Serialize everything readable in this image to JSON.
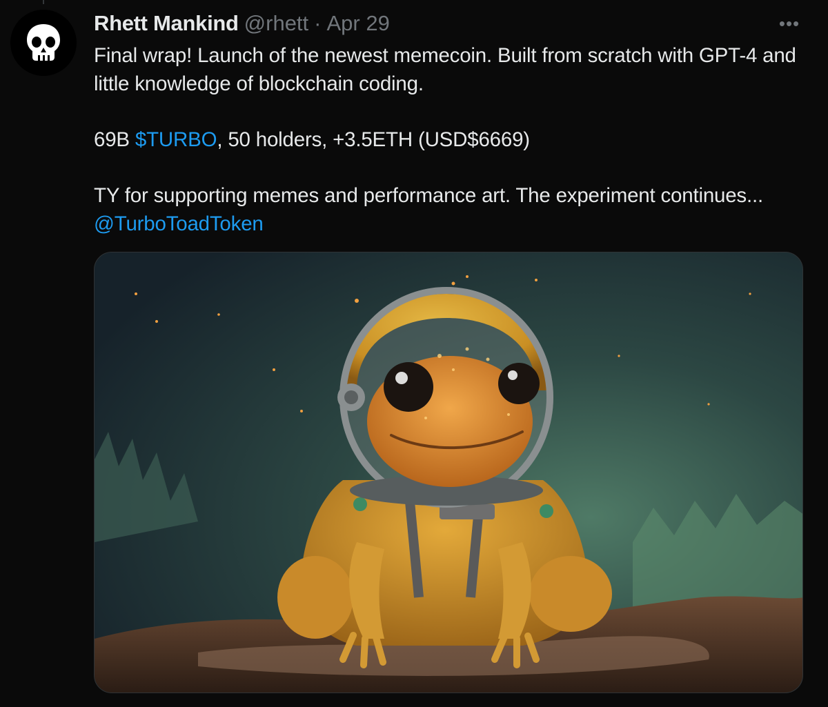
{
  "tweet": {
    "author": {
      "display_name": "Rhett Mankind",
      "handle": "@rhett",
      "avatar_icon": "skull-icon"
    },
    "separator": "·",
    "date": "Apr 29",
    "more_label": "•••",
    "text": {
      "line1": "Final wrap! Launch of the newest memecoin. Built from scratch with GPT-4 and little knowledge of blockchain coding.",
      "line2_prefix": "69B ",
      "line2_cashtag": "$TURBO",
      "line2_suffix": ", 50 holders, +3.5ETH (USD$6669)",
      "line3_prefix": "TY for supporting memes and performance art. The experiment continues... ",
      "line3_mention": "@TurboToadToken"
    },
    "media": {
      "type": "image",
      "icon": "astronaut-toad-illustration"
    }
  },
  "colors": {
    "background": "#0a0a0a",
    "text": "#e7e9ea",
    "secondary": "#71767b",
    "link": "#1d9bf0"
  }
}
